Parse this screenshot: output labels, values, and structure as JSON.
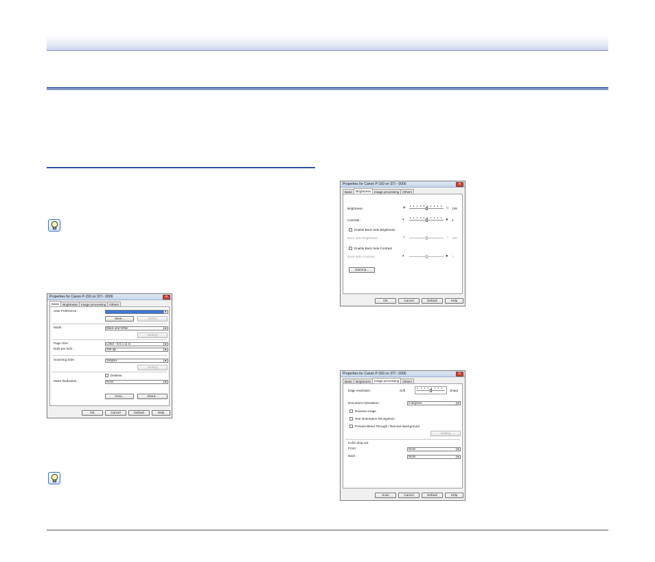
{
  "dialog1": {
    "title": "Properties for Canon P-150 on STI - 0000",
    "tabs": [
      "Basic",
      "Brightness",
      "Image processing",
      "Others"
    ],
    "user_preference_label": "User Preference :",
    "save_btn": "Save...",
    "delete_btn": "Delete",
    "mode_label": "Mode :",
    "mode_value": "Black and White",
    "setting_btn": "Setting",
    "page_size_label": "Page Size :",
    "page_size_value": "Letter - 8.5 x 11 in",
    "dpi_label": "Dots per inch :",
    "dpi_value": "200 dpi",
    "scanning_side_label": "Scanning Side :",
    "scanning_side_value": "Simplex",
    "setting_btn2": "Setting",
    "deskew_label": "Deskew",
    "moire_label": "Moire Reduction :",
    "moire_value": "None",
    "area_btn": "Area...",
    "about_btn": "About...",
    "ok": "OK",
    "cancel": "Cancel",
    "default": "Default",
    "help": "Help"
  },
  "dialog2": {
    "title": "Properties for Canon P-150 on STI - 0000",
    "tabs": [
      "Basic",
      "Brightness",
      "Image processing",
      "Others"
    ],
    "brightness_label": "Brightness :",
    "brightness_value": "128",
    "brightness_level": 0.5,
    "contrast_label": "Contrast :",
    "contrast_value": "4",
    "contrast_level": 0.5,
    "enable_back_brightness": "Enable Back Side Brightness",
    "back_brightness_label": "Back Side Brightness :",
    "back_brightness_value": "128",
    "enable_back_contrast": "Enable Back Side Contrast",
    "back_contrast_label": "Back Side Contrast :",
    "back_contrast_value": "1",
    "gamma_btn": "Gamma...",
    "ok": "OK",
    "cancel": "Cancel",
    "default": "Default",
    "help": "Help"
  },
  "dialog3": {
    "title": "Properties for Canon P-150 on STI - 0000",
    "tabs": [
      "Basic",
      "Brightness",
      "Image processing",
      "Others"
    ],
    "edge_label": "Edge emphasis :",
    "edge_soft": "Soft",
    "edge_sharp": "Sharp",
    "orientation_label": "Document Orientation :",
    "orientation_value": "0 degrees",
    "reverse_image": "Reverse image",
    "text_orientation": "Text Orientation Recognition",
    "prevent_bleed": "Prevent Bleed Through / Remove Background",
    "setting_btn": "Setting",
    "color_dropout_label": "Color drop-out",
    "front_label": "Front :",
    "front_value": "None",
    "back_label": "Back :",
    "back_value": "None",
    "scan": "Scan",
    "cancel": "Cancel",
    "default": "Default",
    "help": "Help"
  }
}
